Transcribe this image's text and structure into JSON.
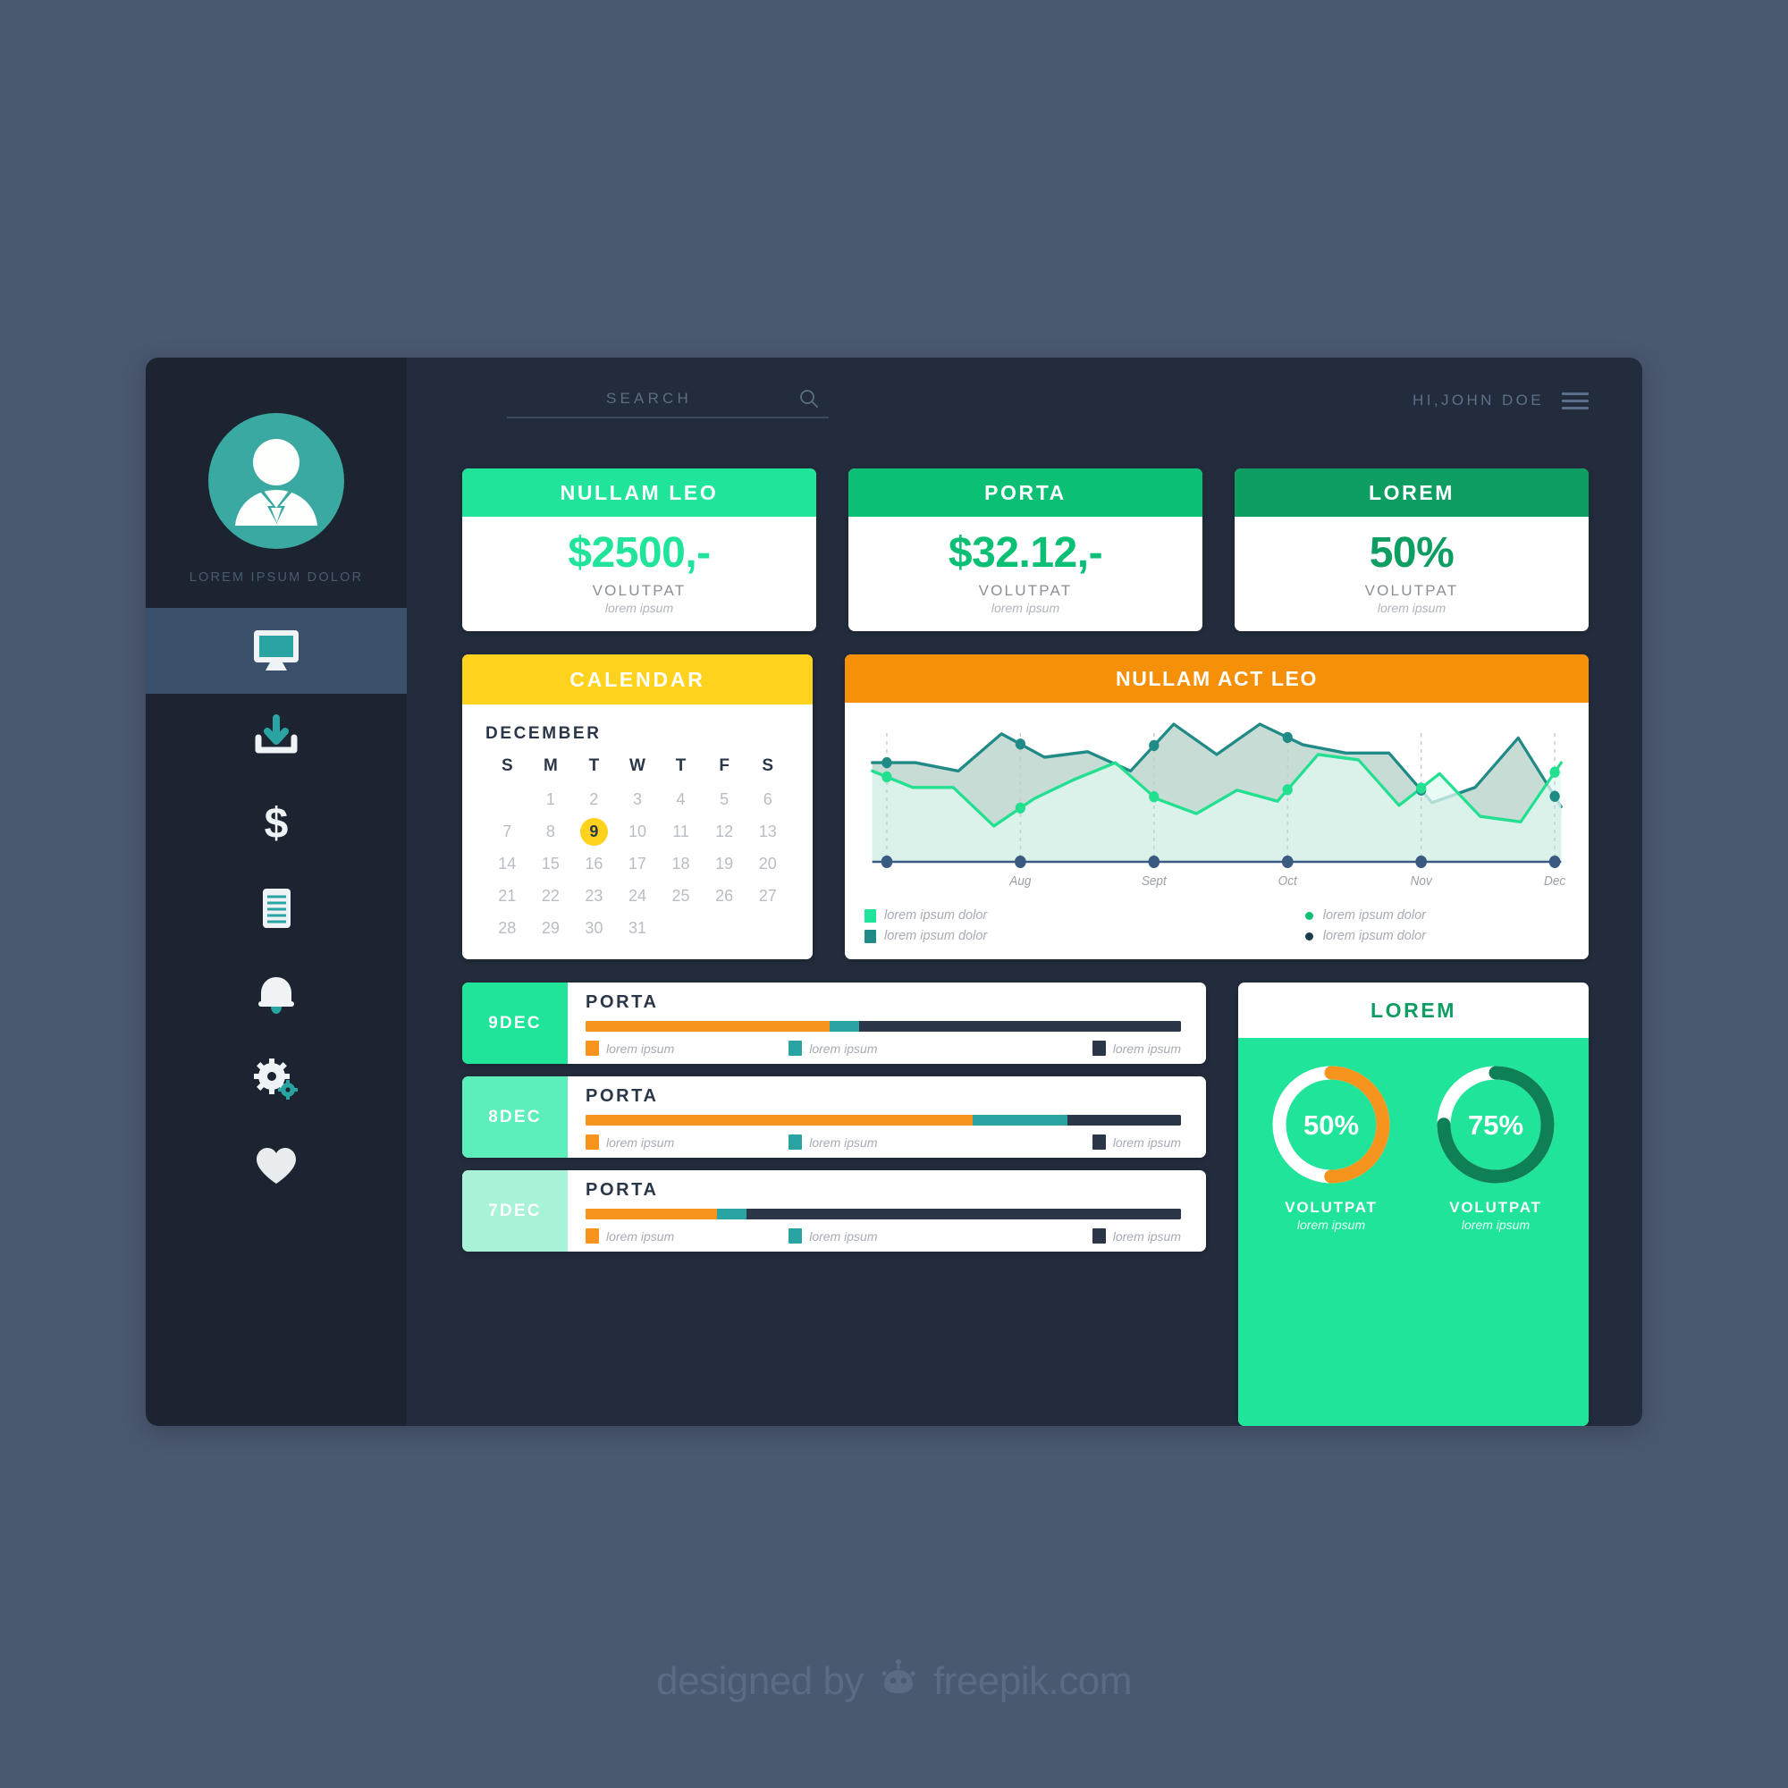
{
  "app": {
    "background_color": "#4a5870",
    "panel_bg": "#222c3c",
    "sidebar_bg": "#1b2430"
  },
  "sidebar": {
    "profile": {
      "avatar_icon": "user-avatar-icon",
      "avatar_color": "#3aa9a2",
      "name": "LOREM IPSUM DOLOR"
    },
    "items": [
      {
        "icon": "monitor-icon",
        "name": "dashboard",
        "active": true
      },
      {
        "icon": "download-inbox-icon",
        "name": "downloads",
        "active": false
      },
      {
        "icon": "dollar-icon",
        "name": "finance",
        "active": false
      },
      {
        "icon": "document-icon",
        "name": "documents",
        "active": false
      },
      {
        "icon": "bell-icon",
        "name": "notifications",
        "active": false
      },
      {
        "icon": "gears-icon",
        "name": "settings",
        "active": false
      },
      {
        "icon": "heart-icon",
        "name": "favorites",
        "active": false
      }
    ]
  },
  "header": {
    "search": {
      "placeholder": "SEARCH",
      "value": "",
      "icon": "search-icon"
    },
    "greeting": "HI,JOHN DOE",
    "menu_icon": "hamburger-menu-icon"
  },
  "stats": [
    {
      "title": "NULLAM LEO",
      "value": "$2500,-",
      "sub": "VOLUTPAT",
      "sub2": "lorem ipsum",
      "head_color": "#1fe49a",
      "value_color": "#1fe49a"
    },
    {
      "title": "PORTA",
      "value": "$32.12,-",
      "sub": "VOLUTPAT",
      "sub2": "lorem ipsum",
      "head_color": "#0bbf75",
      "value_color": "#0bbf75"
    },
    {
      "title": "LOREM",
      "value": "50%",
      "sub": "VOLUTPAT",
      "sub2": "lorem ipsum",
      "head_color": "#0f9e62",
      "value_color": "#0f9e62"
    }
  ],
  "calendar": {
    "title": "CALENDAR",
    "header_color": "#ffd21e",
    "month": "DECEMBER",
    "dow": [
      "S",
      "M",
      "T",
      "W",
      "T",
      "F",
      "S"
    ],
    "lead_blanks": 1,
    "days": [
      1,
      2,
      3,
      4,
      5,
      6,
      7,
      8,
      9,
      10,
      11,
      12,
      13,
      14,
      15,
      16,
      17,
      18,
      19,
      20,
      21,
      22,
      23,
      24,
      25,
      26,
      27,
      28,
      29,
      30,
      31
    ],
    "today": 9,
    "today_bg": "#ffd21e"
  },
  "chart_data": {
    "type": "area",
    "title": "NULLAM ACT LEO",
    "header_color": "#f79009",
    "xlabel": "",
    "ylabel": "",
    "grid": false,
    "x": [
      "",
      "Aug",
      "Sept",
      "Oct",
      "Nov",
      "Dec"
    ],
    "tick_labels": [
      "Aug",
      "Sept",
      "Oct",
      "Nov",
      "Dec"
    ],
    "marker_points_x": [
      0,
      1,
      2,
      3,
      4,
      5
    ],
    "series": [
      {
        "name": "lorem ipsum dolor",
        "color": "#1f8a86",
        "fill": "#bdd6ce",
        "marker_color": "#1f8a86",
        "values": [
          72,
          72,
          66,
          93,
          76,
          80,
          66,
          100,
          78,
          100,
          85,
          79,
          79,
          43,
          54,
          90,
          40
        ]
      },
      {
        "name": "lorem ipsum dolor",
        "color": "#22e08f",
        "fill": "#e0faf0",
        "marker_color": "#22e08f",
        "values": [
          66,
          54,
          54,
          26,
          46,
          60,
          72,
          46,
          35,
          52,
          44,
          78,
          74,
          41,
          64,
          33,
          29,
          72
        ]
      }
    ],
    "legend": {
      "position": "bottom",
      "left": [
        {
          "label": "lorem ipsum dolor",
          "marker": "square",
          "color": "#1fe49a"
        },
        {
          "label": "lorem ipsum dolor",
          "marker": "square",
          "color": "#1f8a86"
        }
      ],
      "right": [
        {
          "label": "lorem ipsum dolor",
          "marker": "dot",
          "color": "#0bbf75"
        },
        {
          "label": "lorem ipsum dolor",
          "marker": "dot",
          "color": "#1b3a4e"
        }
      ]
    },
    "axis_dot_color": "#3a5a80"
  },
  "tasks": {
    "rows": [
      {
        "date": "9DEC",
        "date_bg": "#1fe49a",
        "title": "PORTA",
        "segments": [
          {
            "color": "#f7941e",
            "pct": 41
          },
          {
            "color": "#2aa3a3",
            "pct": 5
          },
          {
            "color": "#2b3648",
            "pct": 54
          }
        ],
        "legend": [
          {
            "label": "lorem ipsum",
            "color": "#f7941e"
          },
          {
            "label": "lorem ipsum",
            "color": "#2aa3a3"
          },
          {
            "label": "lorem ipsum",
            "color": "#2b3648"
          }
        ]
      },
      {
        "date": "8DEC",
        "date_bg": "#5ceebb",
        "title": "PORTA",
        "segments": [
          {
            "color": "#f7941e",
            "pct": 65
          },
          {
            "color": "#2aa3a3",
            "pct": 16
          },
          {
            "color": "#2b3648",
            "pct": 19
          }
        ],
        "legend": [
          {
            "label": "lorem ipsum",
            "color": "#f7941e"
          },
          {
            "label": "lorem ipsum",
            "color": "#2aa3a3"
          },
          {
            "label": "lorem ipsum",
            "color": "#2b3648"
          }
        ]
      },
      {
        "date": "7DEC",
        "date_bg": "#a8f2d7",
        "title": "PORTA",
        "segments": [
          {
            "color": "#f7941e",
            "pct": 22
          },
          {
            "color": "#2aa3a3",
            "pct": 5
          },
          {
            "color": "#2b3648",
            "pct": 73
          }
        ],
        "legend": [
          {
            "label": "lorem ipsum",
            "color": "#f7941e"
          },
          {
            "label": "lorem ipsum",
            "color": "#2aa3a3"
          },
          {
            "label": "lorem ipsum",
            "color": "#2b3648"
          }
        ]
      }
    ]
  },
  "donut_panel": {
    "title": "LOREM",
    "title_color": "#0f9e62",
    "body_bg": "#1fe49a",
    "donuts": [
      {
        "value": "50%",
        "pct": 50,
        "arc_color": "#f7941e",
        "track_color": "#ffffff",
        "label": "VOLUTPAT",
        "sub": "lorem ipsum"
      },
      {
        "value": "75%",
        "pct": 75,
        "arc_color": "#0f7f55",
        "track_color": "#ffffff",
        "label": "VOLUTPAT",
        "sub": "lorem ipsum"
      }
    ]
  },
  "watermark": {
    "text_before": "designed by",
    "text_after": "freepik.com",
    "icon": "freepik-logo-icon"
  }
}
